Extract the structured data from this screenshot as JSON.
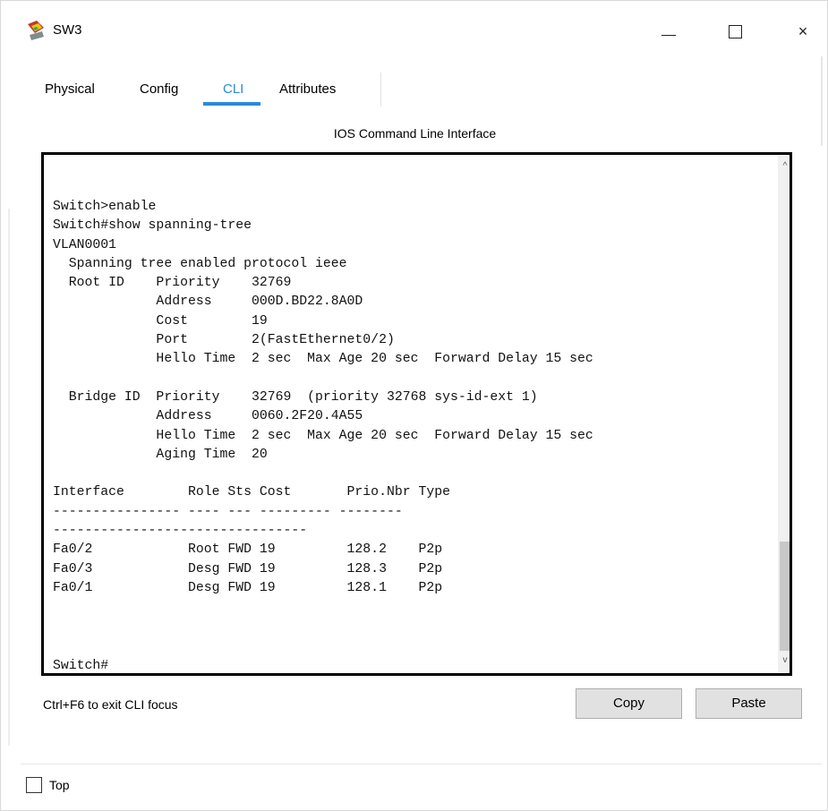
{
  "window": {
    "title": "SW3",
    "icon": "switch-app-icon",
    "controls": {
      "minimize": "minimize-icon",
      "maximize": "maximize-icon",
      "close": "×"
    }
  },
  "tabs": [
    {
      "label": "Physical",
      "active": false
    },
    {
      "label": "Config",
      "active": false
    },
    {
      "label": "CLI",
      "active": true
    },
    {
      "label": "Attributes",
      "active": false
    }
  ],
  "heading": "IOS Command Line Interface",
  "terminal": {
    "output": "Switch>enable\nSwitch#show spanning-tree\nVLAN0001\n  Spanning tree enabled protocol ieee\n  Root ID    Priority    32769\n             Address     000D.BD22.8A0D\n             Cost        19\n             Port        2(FastEthernet0/2)\n             Hello Time  2 sec  Max Age 20 sec  Forward Delay 15 sec\n\n  Bridge ID  Priority    32769  (priority 32768 sys-id-ext 1)\n             Address     0060.2F20.4A55\n             Hello Time  2 sec  Max Age 20 sec  Forward Delay 15 sec\n             Aging Time  20\n\nInterface        Role Sts Cost       Prio.Nbr Type\n---------------- ---- --- --------- --------\n--------------------------------\nFa0/2            Root FWD 19         128.2    P2p\nFa0/3            Desg FWD 19         128.3    P2p\nFa0/1            Desg FWD 19         128.1    P2p",
    "prompt": "Switch#",
    "scroll_up": "^",
    "scroll_down": "v"
  },
  "footer": {
    "hint": "Ctrl+F6 to exit CLI focus",
    "copy_label": "Copy",
    "paste_label": "Paste",
    "top_label": "Top",
    "top_checked": false
  },
  "colors": {
    "accent": "#2a8bd8",
    "button_bg": "#e1e1e1",
    "terminal_border": "#000000"
  }
}
